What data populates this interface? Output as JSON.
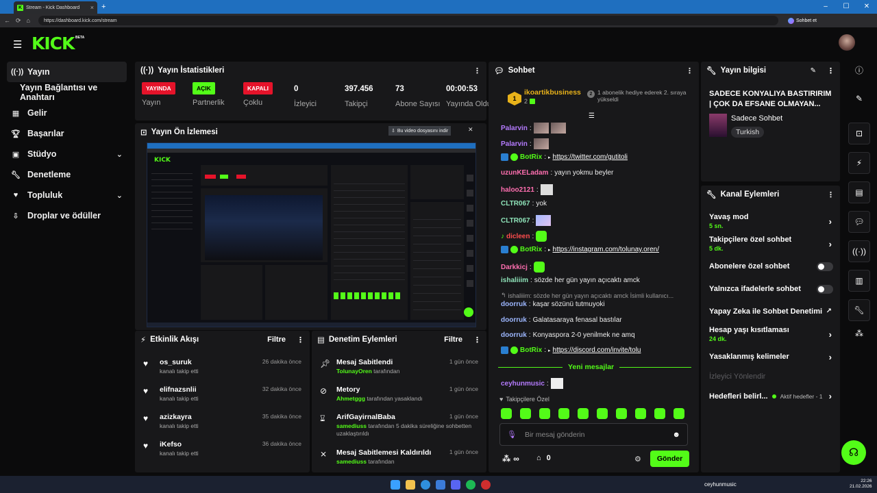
{
  "browser": {
    "tab_title": "Stream - Kick Dashboard",
    "tab_close": "×",
    "new_tab": "+",
    "url": "https://dashboard.kick.com/stream",
    "chat_label": "Sohbet et"
  },
  "brand": {
    "logo": "KICK",
    "beta": "BETA",
    "accent": "#53fc18"
  },
  "sidebar": {
    "items": [
      {
        "label": "Yayın",
        "icon": "broadcast-icon"
      },
      {
        "label": "Yayın Bağlantısı ve Anahtarı",
        "icon": ""
      },
      {
        "label": "Gelir",
        "icon": "chart-icon"
      },
      {
        "label": "Başarılar",
        "icon": "trophy-icon"
      },
      {
        "label": "Stüdyo",
        "icon": "studio-icon"
      },
      {
        "label": "Denetleme",
        "icon": "wrench-icon"
      },
      {
        "label": "Topluluk",
        "icon": "community-icon"
      },
      {
        "label": "Droplar ve ödüller",
        "icon": "drops-icon"
      }
    ]
  },
  "stats": {
    "title": "Yayın İstatistikleri",
    "items": [
      {
        "value": "YAYINDA",
        "label": "Yayın",
        "kind": "badge-red"
      },
      {
        "value": "AÇIK",
        "label": "Partnerlik",
        "kind": "badge-green"
      },
      {
        "value": "KAPALI",
        "label": "Çoklu",
        "kind": "badge-red"
      },
      {
        "value": "0",
        "label": "İzleyici"
      },
      {
        "value": "397.456",
        "label": "Takipçi"
      },
      {
        "value": "73",
        "label": "Abone Sayısı"
      },
      {
        "value": "00:00:53",
        "label": "Yayında Olduğu"
      }
    ]
  },
  "preview": {
    "title": "Yayın Ön İzlemesi",
    "download": "Bu video dosyasını indir"
  },
  "activity": {
    "title": "Etkinlik Akışı",
    "filter": "Filtre",
    "items": [
      {
        "name": "os_suruk",
        "text": "kanalı takip etti",
        "time": "26 dakika önce"
      },
      {
        "name": "elifnazsnlii",
        "text": "kanalı takip etti",
        "time": "32 dakika önce"
      },
      {
        "name": "azizkayra",
        "text": "kanalı takip etti",
        "time": "35 dakika önce"
      },
      {
        "name": "iKefso",
        "text": "kanalı takip etti",
        "time": "36 dakika önce"
      }
    ]
  },
  "moderation": {
    "title": "Denetim Eylemleri",
    "filter": "Filtre",
    "items": [
      {
        "title": "Mesaj Sabitlendi",
        "who": "TolunayOren",
        "rest": "tarafından",
        "time": "1 gün önce",
        "icon": "pin-icon"
      },
      {
        "title": "Metory",
        "who": "Ahmetggg",
        "rest": "tarafından yasaklandı",
        "time": "1 gün önce",
        "icon": "ban-icon"
      },
      {
        "title": "ArifGayirnalBaba",
        "who": "samediuss",
        "rest": "tarafından 5 dakika süreliğine sohbetten uzaklaştırıldı",
        "time": "1 gün önce",
        "icon": "hourglass-icon"
      },
      {
        "title": "Mesaj Sabitlemesi Kaldırıldı",
        "who": "samediuss",
        "rest": "tarafından",
        "time": "1 gün önce",
        "icon": "unpin-icon"
      }
    ]
  },
  "chat": {
    "title": "Sohbet",
    "top_user": "ikoartikbusiness",
    "top_user_count": "2",
    "top_rank": "1",
    "gift_rank": "2",
    "gift_text": "1 abonelik hediye ederek 2. sıraya yükseldi",
    "messages": [
      {
        "user": "Palarvin",
        "sep": ":",
        "text": ""
      },
      {
        "user": "Palarvin",
        "sep": ":",
        "text": ""
      },
      {
        "user": "BotRix",
        "sep": ":",
        "text": "https://twitter.com/gutitoli"
      },
      {
        "user": "uzunKELadam",
        "sep": ":",
        "text": "yayın yokmu beyler"
      },
      {
        "user": "haloo2121",
        "sep": ":",
        "text": ""
      },
      {
        "user": "CLTR067",
        "sep": ":",
        "text": "yok"
      },
      {
        "user": "CLTR067",
        "sep": ":",
        "text": ""
      },
      {
        "user": "dicleen",
        "sep": ":",
        "text": ""
      },
      {
        "user": "BotRix",
        "sep": ":",
        "text": "https://instagram.com/tolunay.oren/"
      },
      {
        "user": "Darkkicj",
        "sep": ":",
        "text": ""
      },
      {
        "user": "ishaliiim",
        "sep": ":",
        "text": "sözde her gün yayın açıcaktı amck"
      },
      {
        "user": "",
        "sep": "",
        "text": "ishaliiim: sözde her gün yayın açıcaktı amck İsimli kullanıcı..."
      },
      {
        "user": "doorruk",
        "sep": ":",
        "text": "kaşar sözünü tutmuyoki"
      },
      {
        "user": "doorruk",
        "sep": ":",
        "text": "Galatasaraya fenasal bastılar"
      },
      {
        "user": "doorruk",
        "sep": ":",
        "text": "Konyaspora 2-0 yenilmek ne amq"
      },
      {
        "user": "BotRix",
        "sep": ":",
        "text": "https://discord.com/invite/tolu"
      }
    ],
    "new_messages": "Yeni mesajlar",
    "last_user": "ceyhunmusic",
    "followers_only": "Takipçilere Özel",
    "input_placeholder": "Bir mesaj gönderin",
    "points": "0",
    "send": "Gönder",
    "infinity": "∞"
  },
  "info": {
    "title": "Yayın bilgisi",
    "stream_title": "SADECE KONYALIYA BASTIRIRIM | ÇOK DA EFSANE OLMAYAN...",
    "category": "Sadece Sohbet",
    "language": "Turkish"
  },
  "actions": {
    "title": "Kanal Eylemleri",
    "items": [
      {
        "label": "Yavaş mod",
        "sub": "5 sn.",
        "type": "arrow"
      },
      {
        "label": "Takipçilere özel sohbet",
        "sub": "5 dk.",
        "type": "arrow"
      },
      {
        "label": "Abonelere özel sohbet",
        "sub": "",
        "type": "toggle"
      },
      {
        "label": "Yalnızca ifadelerle sohbet",
        "sub": "",
        "type": "toggle"
      },
      {
        "label": "Yapay Zeka ile Sohbet Denetimi",
        "sub": "",
        "type": "external"
      },
      {
        "label": "Hesap yaşı kısıtlaması",
        "sub": "24 dk.",
        "type": "arrow"
      },
      {
        "label": "Yasaklanmış kelimeler",
        "sub": "",
        "type": "arrow"
      },
      {
        "label": "İzleyici Yönlendir",
        "sub": "",
        "type": "disabled"
      },
      {
        "label": "Hedefleri belirl...",
        "sub": "Aktif hedefler - 1",
        "type": "arrow"
      }
    ]
  },
  "taskbar": {
    "user": "ceyhunmusic",
    "time": "22:26",
    "date": "21.02.2026"
  }
}
